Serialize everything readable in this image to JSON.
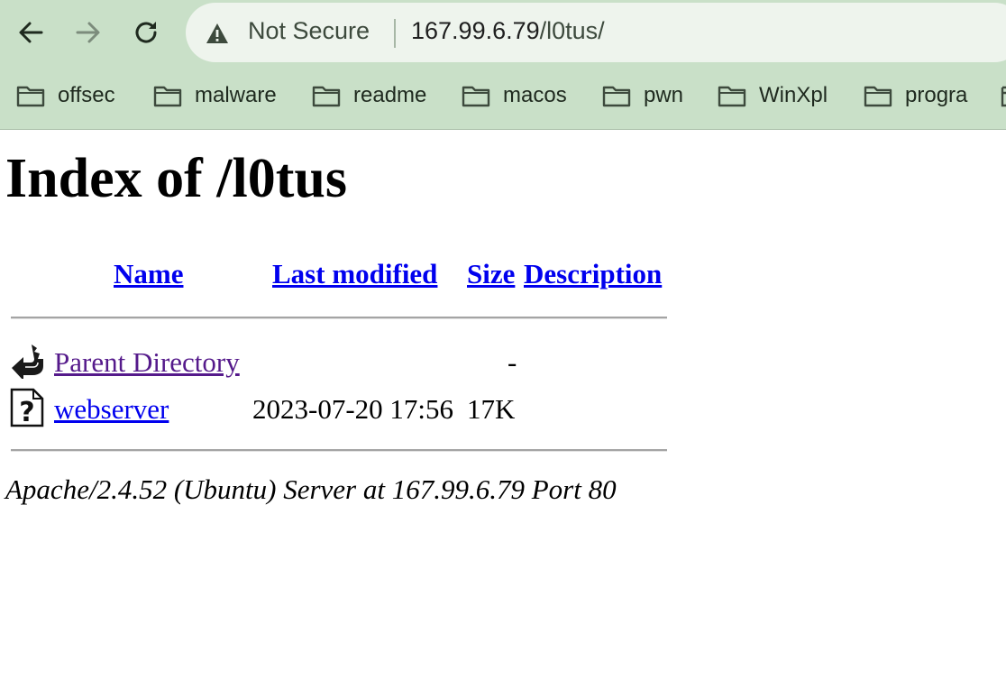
{
  "browser": {
    "security_label": "Not Secure",
    "url_host": "167.99.6.79",
    "url_path": "/l0tus/",
    "bookmarks": [
      "offsec",
      "malware",
      "readme",
      "macos",
      "pwn",
      "WinXpl",
      "progra"
    ]
  },
  "page": {
    "title": "Index of /l0tus",
    "columns": {
      "name": "Name",
      "last_modified": "Last modified",
      "size": "Size",
      "description": "Description"
    },
    "rows": [
      {
        "icon": "back-icon",
        "name": "Parent Directory",
        "last_modified": "",
        "size": "-",
        "description": ""
      },
      {
        "icon": "unknown-file-icon",
        "name": "webserver",
        "last_modified": "2023-07-20 17:56",
        "size": "17K",
        "description": ""
      }
    ],
    "footer": "Apache/2.4.52 (Ubuntu) Server at 167.99.6.79 Port 80"
  },
  "colors": {
    "toolbar_bg": "#c9e0c8",
    "link": "#0000ee",
    "visited_link": "#551a8b"
  }
}
